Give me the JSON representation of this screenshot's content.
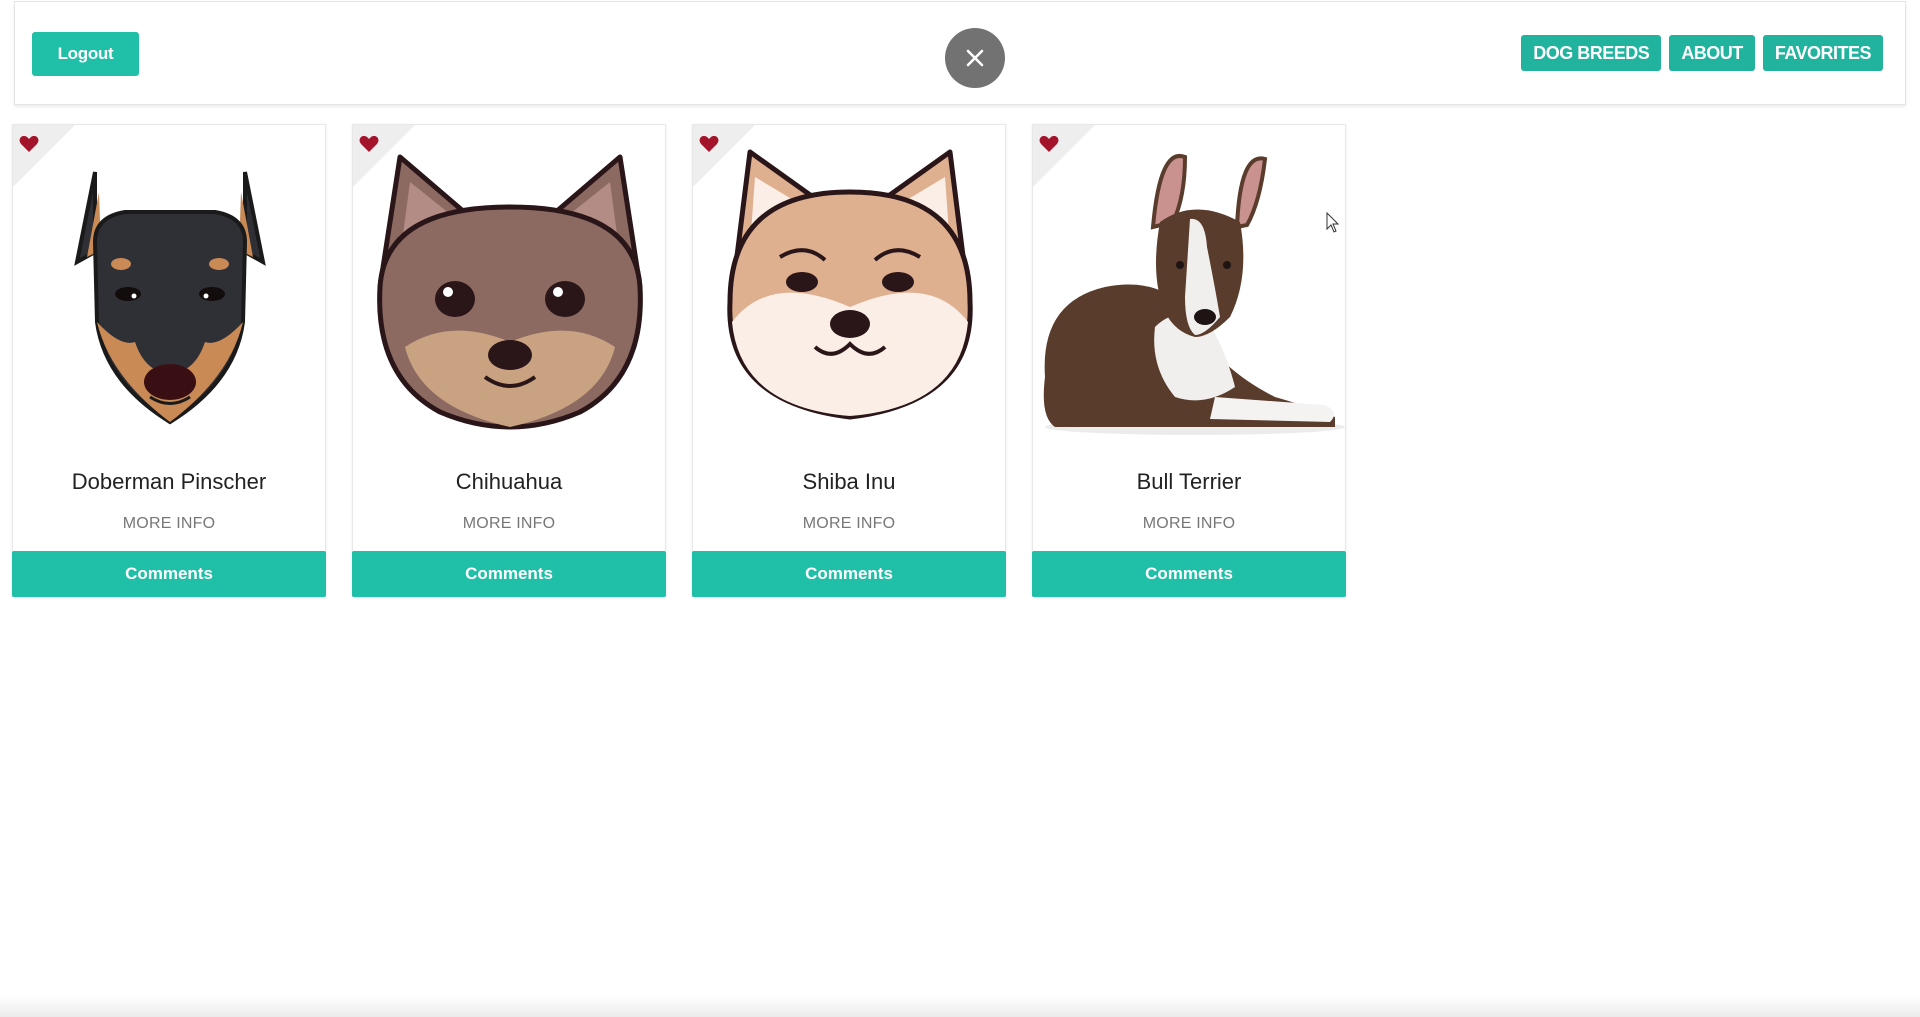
{
  "header": {
    "logout_label": "Logout",
    "close_icon": "close-icon",
    "nav": [
      {
        "label": "DOG BREEDS"
      },
      {
        "label": "ABOUT"
      },
      {
        "label": "FAVORITES"
      }
    ]
  },
  "cards": [
    {
      "title": "Doberman Pinscher",
      "more_info": "MORE INFO",
      "comments": "Comments",
      "image": "doberman-illustration"
    },
    {
      "title": "Chihuahua",
      "more_info": "MORE INFO",
      "comments": "Comments",
      "image": "chihuahua-illustration"
    },
    {
      "title": "Shiba Inu",
      "more_info": "MORE INFO",
      "comments": "Comments",
      "image": "shiba-inu-illustration"
    },
    {
      "title": "Bull Terrier",
      "more_info": "MORE INFO",
      "comments": "Comments",
      "image": "bull-terrier-photo"
    }
  ],
  "colors": {
    "accent": "#20bfa7",
    "heart": "#a3142a",
    "close_circle": "#727272"
  }
}
